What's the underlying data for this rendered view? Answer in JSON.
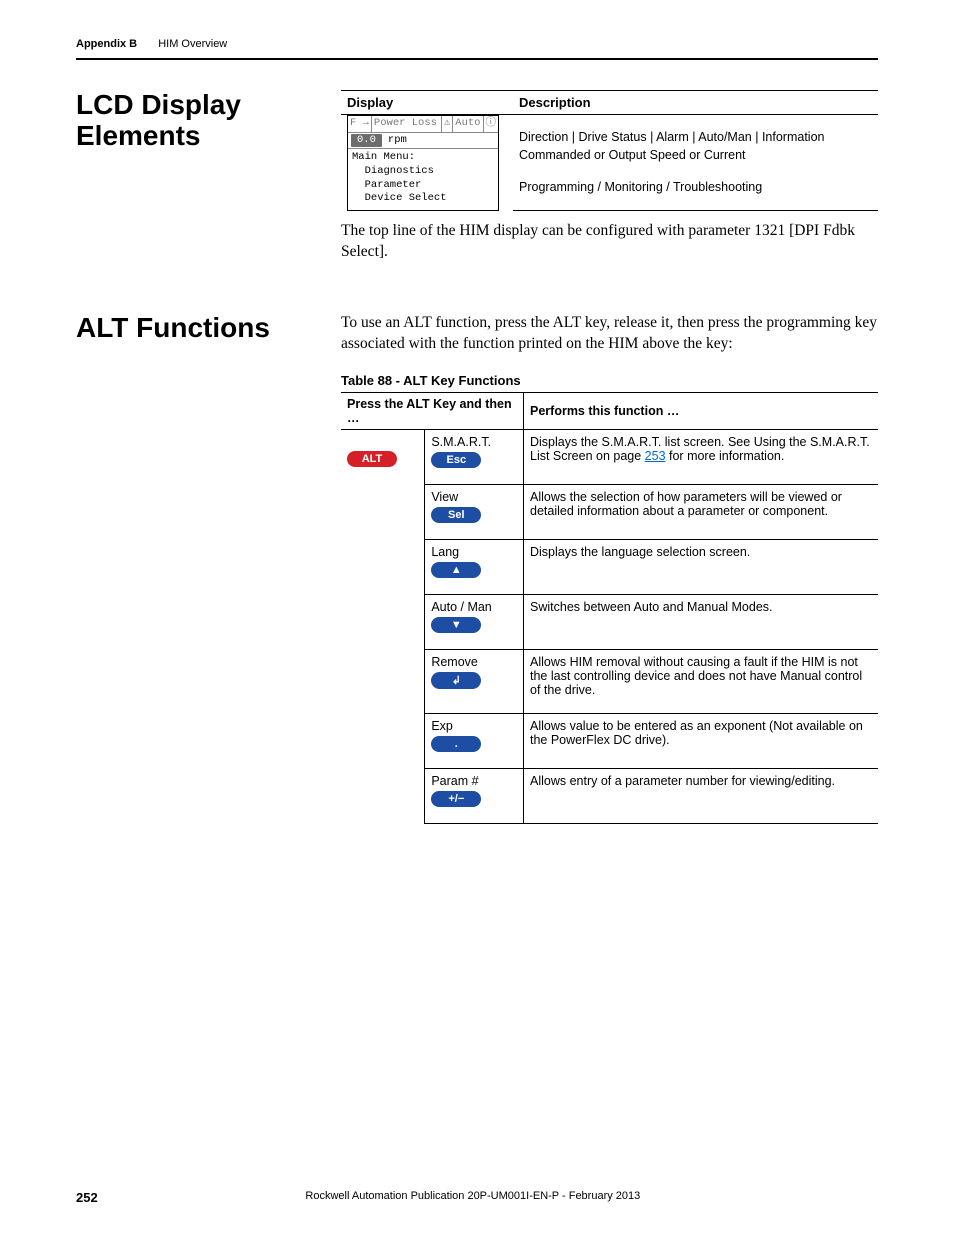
{
  "runhead": {
    "appendix": "Appendix B",
    "chapter": "HIM Overview"
  },
  "section1": {
    "heading": "LCD Display Elements",
    "table_headers": {
      "c1": "Display",
      "c2": "Description"
    },
    "lcd": {
      "status_prefix": "F",
      "status_text": "Power Loss",
      "auto_text": "Auto",
      "speed_box": "0.0",
      "speed_unit": "rpm",
      "menu_text": "Main Menu:\n  Diagnostics\n  Parameter\n  Device Select"
    },
    "desc_row1": "Direction | Drive Status | Alarm | Auto/Man | Information",
    "desc_row2": "Commanded or Output Speed or Current",
    "desc_row3": "Programming / Monitoring / Troubleshooting",
    "body": "The top line of the HIM display can be configured with parameter 1321 [DPI Fdbk Select]."
  },
  "section2": {
    "heading": "ALT Functions",
    "body": "To use an ALT function, press the ALT key, release it, then press the programming key associated with the function printed on the HIM above the key:",
    "caption": "Table 88 - ALT Key Functions",
    "headers": {
      "c1": "Press the ALT Key and then …",
      "c2": "Performs this function …"
    },
    "alt_label": "ALT",
    "rows": [
      {
        "label": "S.M.A.R.T.",
        "key_text": "Esc",
        "key_glyph": "",
        "desc_pre": "Displays the S.M.A.R.T. list screen. See Using the S.M.A.R.T. List Screen on page ",
        "page_link": "253",
        "desc_post": " for more information."
      },
      {
        "label": "View",
        "key_text": "Sel",
        "key_glyph": "",
        "desc_pre": "Allows the selection of how parameters will be viewed or detailed information about a parameter or component.",
        "page_link": "",
        "desc_post": ""
      },
      {
        "label": "Lang",
        "key_text": "",
        "key_glyph": "▲",
        "desc_pre": "Displays the language selection screen.",
        "page_link": "",
        "desc_post": ""
      },
      {
        "label": "Auto / Man",
        "key_text": "",
        "key_glyph": "▼",
        "desc_pre": "Switches between Auto and Manual Modes.",
        "page_link": "",
        "desc_post": ""
      },
      {
        "label": "Remove",
        "key_text": "",
        "key_glyph": "↲",
        "desc_pre": "Allows HIM removal without causing a fault if the HIM is not the last controlling device and does not have Manual control of the drive.",
        "page_link": "",
        "desc_post": ""
      },
      {
        "label": "Exp",
        "key_text": "",
        "key_glyph": ".",
        "desc_pre": "Allows value to be entered as an exponent (Not available on the PowerFlex DC drive).",
        "page_link": "",
        "desc_post": ""
      },
      {
        "label": "Param #",
        "key_text": "",
        "key_glyph": "+/−",
        "desc_pre": "Allows entry of a parameter number for viewing/editing.",
        "page_link": "",
        "desc_post": ""
      }
    ]
  },
  "footer": {
    "page": "252",
    "pub": "Rockwell Automation Publication 20P-UM001I-EN-P - February 2013"
  }
}
